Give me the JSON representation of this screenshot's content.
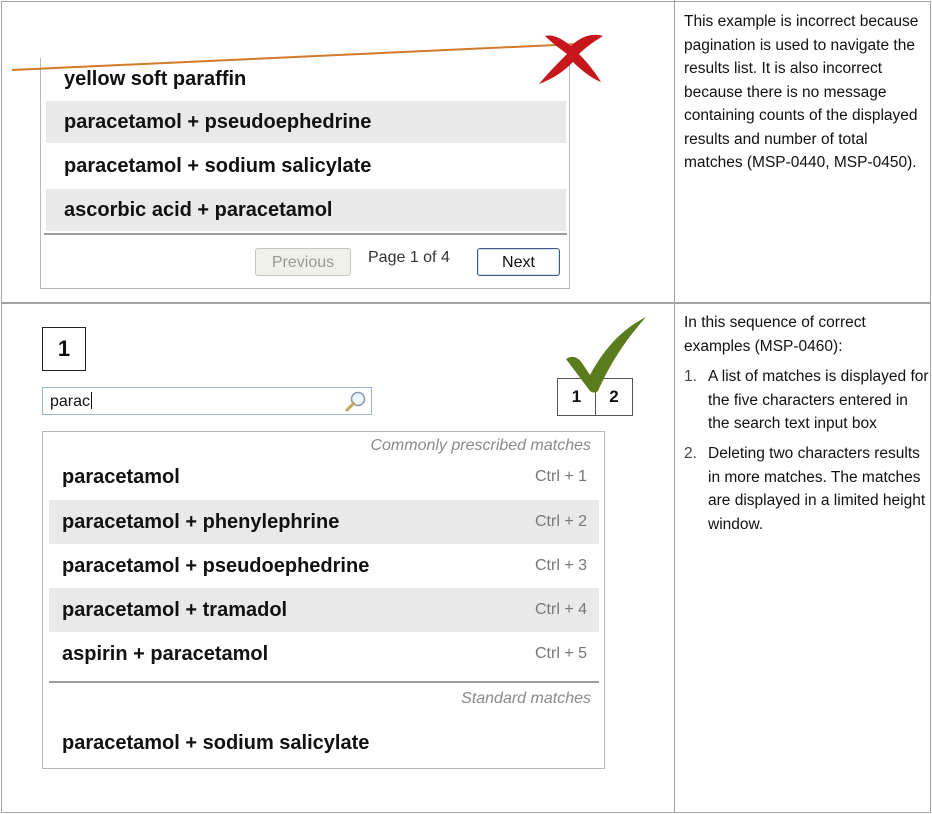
{
  "example1": {
    "rows": [
      "yellow soft paraffin",
      "paracetamol + pseudoephedrine",
      "paracetamol + sodium salicylate",
      "ascorbic acid + paracetamol"
    ],
    "pagination": {
      "previous_label": "Previous",
      "page_text": "Page 1 of 4",
      "next_label": "Next"
    },
    "note": "This example is incorrect because pagination is used to navigate the results list. It is also incorrect because there is no message containing counts of the displayed results and number of total matches (MSP-0440, MSP-0450)."
  },
  "example2": {
    "step_label": "1",
    "search": {
      "value": "parac"
    },
    "sequence": [
      "1",
      "2"
    ],
    "commonly_header": "Commonly prescribed matches",
    "common_rows": [
      {
        "name": "paracetamol",
        "shortcut": "Ctrl + 1"
      },
      {
        "name": "paracetamol + phenylephrine",
        "shortcut": "Ctrl + 2"
      },
      {
        "name": "paracetamol + pseudoephedrine",
        "shortcut": "Ctrl + 3"
      },
      {
        "name": "paracetamol + tramadol",
        "shortcut": "Ctrl + 4"
      },
      {
        "name": "aspirin + paracetamol",
        "shortcut": "Ctrl + 5"
      }
    ],
    "standard_header": "Standard matches",
    "standard_rows": [
      {
        "name": "paracetamol + sodium salicylate"
      }
    ],
    "note_intro": "In this sequence of correct examples (MSP-0460):",
    "note_items": [
      {
        "num": "1.",
        "text": "A list of matches is displayed for the five characters entered in the search text input box"
      },
      {
        "num": "2.",
        "text": "Deleting two characters results in more matches. The matches are displayed in a limited height window."
      }
    ]
  },
  "colors": {
    "incorrect_mark": "#c8161d",
    "correct_mark": "#5a7c1c",
    "strike_line": "#d07a2a"
  }
}
